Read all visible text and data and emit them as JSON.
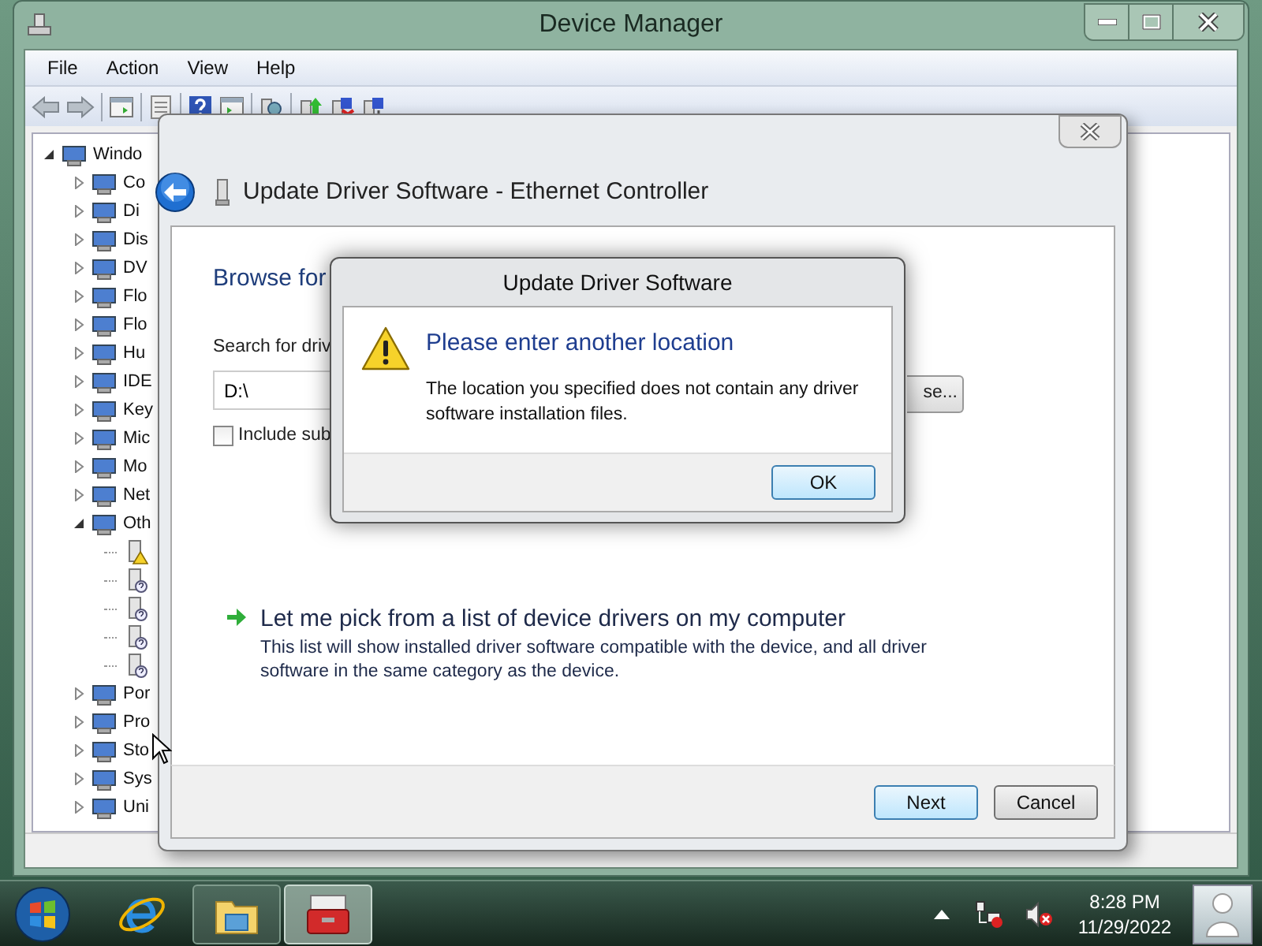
{
  "window": {
    "title": "Device Manager"
  },
  "menu": [
    "File",
    "Action",
    "View",
    "Help"
  ],
  "tree": {
    "items": [
      {
        "label": "Windo",
        "expanded": true,
        "children": [
          {
            "label": "Co",
            "expanded": false
          },
          {
            "label": "Di",
            "expanded": false
          },
          {
            "label": "Dis",
            "expanded": false
          },
          {
            "label": "DV",
            "expanded": false
          },
          {
            "label": "Flo",
            "expanded": false
          },
          {
            "label": "Flo",
            "expanded": false
          },
          {
            "label": "Hu",
            "expanded": false
          },
          {
            "label": "IDE",
            "expanded": false
          },
          {
            "label": "Key",
            "expanded": false
          },
          {
            "label": "Mic",
            "expanded": false
          },
          {
            "label": "Mo",
            "expanded": false
          },
          {
            "label": "Net",
            "expanded": false
          },
          {
            "label": "Oth",
            "expanded": true,
            "children": [
              {
                "kind": "warning"
              },
              {
                "kind": "unknown"
              },
              {
                "kind": "unknown"
              },
              {
                "kind": "unknown"
              },
              {
                "kind": "unknown"
              }
            ]
          },
          {
            "label": "Por",
            "expanded": false
          },
          {
            "label": "Pro",
            "expanded": false
          },
          {
            "label": "Sto",
            "expanded": false
          },
          {
            "label": "Sys",
            "expanded": false
          },
          {
            "label": "Uni",
            "expanded": false
          }
        ]
      }
    ]
  },
  "wizard": {
    "title": "Update Driver Software - Ethernet Controller",
    "heading": "Browse for",
    "search_label": "Search for driv",
    "path_value": "D:\\",
    "include_subfolders": {
      "label": "Include sub",
      "checked": false
    },
    "browse_button": "se...",
    "option": {
      "title": "Let me pick from a list of device drivers on my computer",
      "description": "This list will show installed driver software compatible with the device, and all driver software in the same category as the device."
    },
    "buttons": [
      {
        "label": "Next",
        "default": true
      },
      {
        "label": "Cancel",
        "default": false
      }
    ]
  },
  "message_box": {
    "title": "Update Driver Software",
    "heading": "Please enter another location",
    "body": "The location you specified does not contain any driver software installation files.",
    "button": "OK"
  },
  "taskbar": {
    "buttons": [
      {
        "kind": "explorer",
        "active": false
      },
      {
        "kind": "toolbox",
        "active": true
      }
    ],
    "time": "8:28 PM",
    "date": "11/29/2022"
  }
}
